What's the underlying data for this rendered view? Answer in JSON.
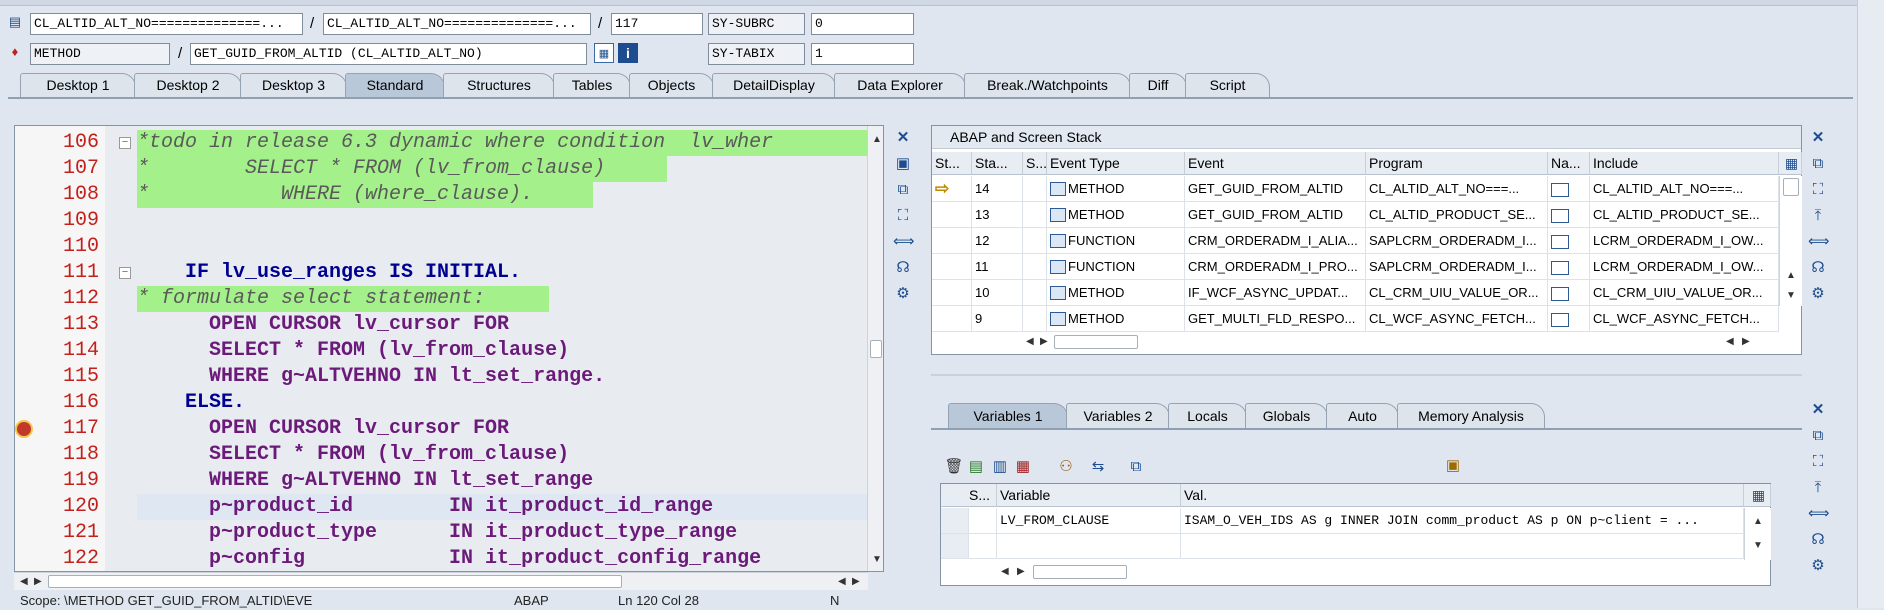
{
  "header": {
    "program1": "CL_ALTID_ALT_NO==============...",
    "program2": "CL_ALTID_ALT_NO==============...",
    "line": "117",
    "subrc_label": "SY-SUBRC",
    "subrc_value": "0",
    "type": "METHOD",
    "method": "GET_GUID_FROM_ALTID (CL_ALTID_ALT_NO)",
    "tabix_label": "SY-TABIX",
    "tabix_value": "1",
    "slash1": "/",
    "slash2": "/",
    "slash3": "/"
  },
  "tabs": [
    "Desktop 1",
    "Desktop 2",
    "Desktop 3",
    "Standard",
    "Structures",
    "Tables",
    "Objects",
    "DetailDisplay",
    "Data Explorer",
    "Break./Watchpoints",
    "Diff",
    "Script"
  ],
  "active_tab": "Standard",
  "code": {
    "lines": [
      {
        "no": "106",
        "text": "*todo in release 6.3 dynamic where condition  lv_wher"
      },
      {
        "no": "107",
        "text": "*        SELECT * FROM (lv_from_clause)"
      },
      {
        "no": "108",
        "text": "*           WHERE (where_clause)."
      },
      {
        "no": "109",
        "text": ""
      },
      {
        "no": "110",
        "text": ""
      },
      {
        "no": "111",
        "text": "    IF lv_use_ranges IS INITIAL."
      },
      {
        "no": "112",
        "text": "* formulate select statement:"
      },
      {
        "no": "113",
        "text": "      OPEN CURSOR lv_cursor FOR"
      },
      {
        "no": "114",
        "text": "      SELECT * FROM (lv_from_clause)"
      },
      {
        "no": "115",
        "text": "      WHERE g~ALTVEHNO IN lt_set_range."
      },
      {
        "no": "116",
        "text": "    ELSE."
      },
      {
        "no": "117",
        "text": "      OPEN CURSOR lv_cursor FOR"
      },
      {
        "no": "118",
        "text": "      SELECT * FROM (lv_from_clause)"
      },
      {
        "no": "119",
        "text": "      WHERE g~ALTVEHNO IN lt_set_range"
      },
      {
        "no": "120",
        "text": "      p~product_id        IN it_product_id_range"
      },
      {
        "no": "121",
        "text": "      p~product_type      IN it_product_type_range"
      },
      {
        "no": "122",
        "text": "      p~config            IN it_product_config_range"
      }
    ]
  },
  "stack": {
    "title": "ABAP and Screen Stack",
    "columns": [
      "St...",
      "Sta...",
      "S...",
      "Event Type",
      "Event",
      "Program",
      "Na...",
      "Include"
    ],
    "rows": [
      {
        "level": "14",
        "type": "METHOD",
        "event": "GET_GUID_FROM_ALTID",
        "program": "CL_ALTID_ALT_NO===...",
        "include": "CL_ALTID_ALT_NO===...",
        "current": true
      },
      {
        "level": "13",
        "type": "METHOD",
        "event": "GET_GUID_FROM_ALTID",
        "program": "CL_ALTID_PRODUCT_SE...",
        "include": "CL_ALTID_PRODUCT_SE...",
        "current": false
      },
      {
        "level": "12",
        "type": "FUNCTION",
        "event": "CRM_ORDERADM_I_ALIA...",
        "program": "SAPLCRM_ORDERADM_I...",
        "include": "LCRM_ORDERADM_I_OW...",
        "current": false
      },
      {
        "level": "11",
        "type": "FUNCTION",
        "event": "CRM_ORDERADM_I_PRO...",
        "program": "SAPLCRM_ORDERADM_I...",
        "include": "LCRM_ORDERADM_I_OW...",
        "current": false
      },
      {
        "level": "10",
        "type": "METHOD",
        "event": "IF_WCF_ASYNC_UPDAT...",
        "program": "CL_CRM_UIU_VALUE_OR...",
        "include": "CL_CRM_UIU_VALUE_OR...",
        "current": false
      },
      {
        "level": "9",
        "type": "METHOD",
        "event": "GET_MULTI_FLD_RESPO...",
        "program": "CL_WCF_ASYNC_FETCH...",
        "include": "CL_WCF_ASYNC_FETCH...",
        "current": false
      }
    ]
  },
  "var_tabs": [
    "Variables 1",
    "Variables 2",
    "Locals",
    "Globals",
    "Auto",
    "Memory Analysis"
  ],
  "variables": {
    "columns": [
      "S...",
      "Variable",
      "Val."
    ],
    "rows": [
      {
        "name": "LV_FROM_CLAUSE",
        "value": "ISAM_O_VEH_IDS AS g INNER JOIN comm_product AS p ON p~client   = ..."
      },
      {
        "name": "",
        "value": ""
      }
    ]
  },
  "status": {
    "scope": "Scope: \\METHOD GET_GUID_FROM_ALTID\\EVE",
    "lang": "ABAP",
    "position": "Ln 120 Col 28",
    "ins": "N"
  },
  "colors": {
    "highlight": "#a4f08a",
    "line_number": "#c3201b"
  }
}
